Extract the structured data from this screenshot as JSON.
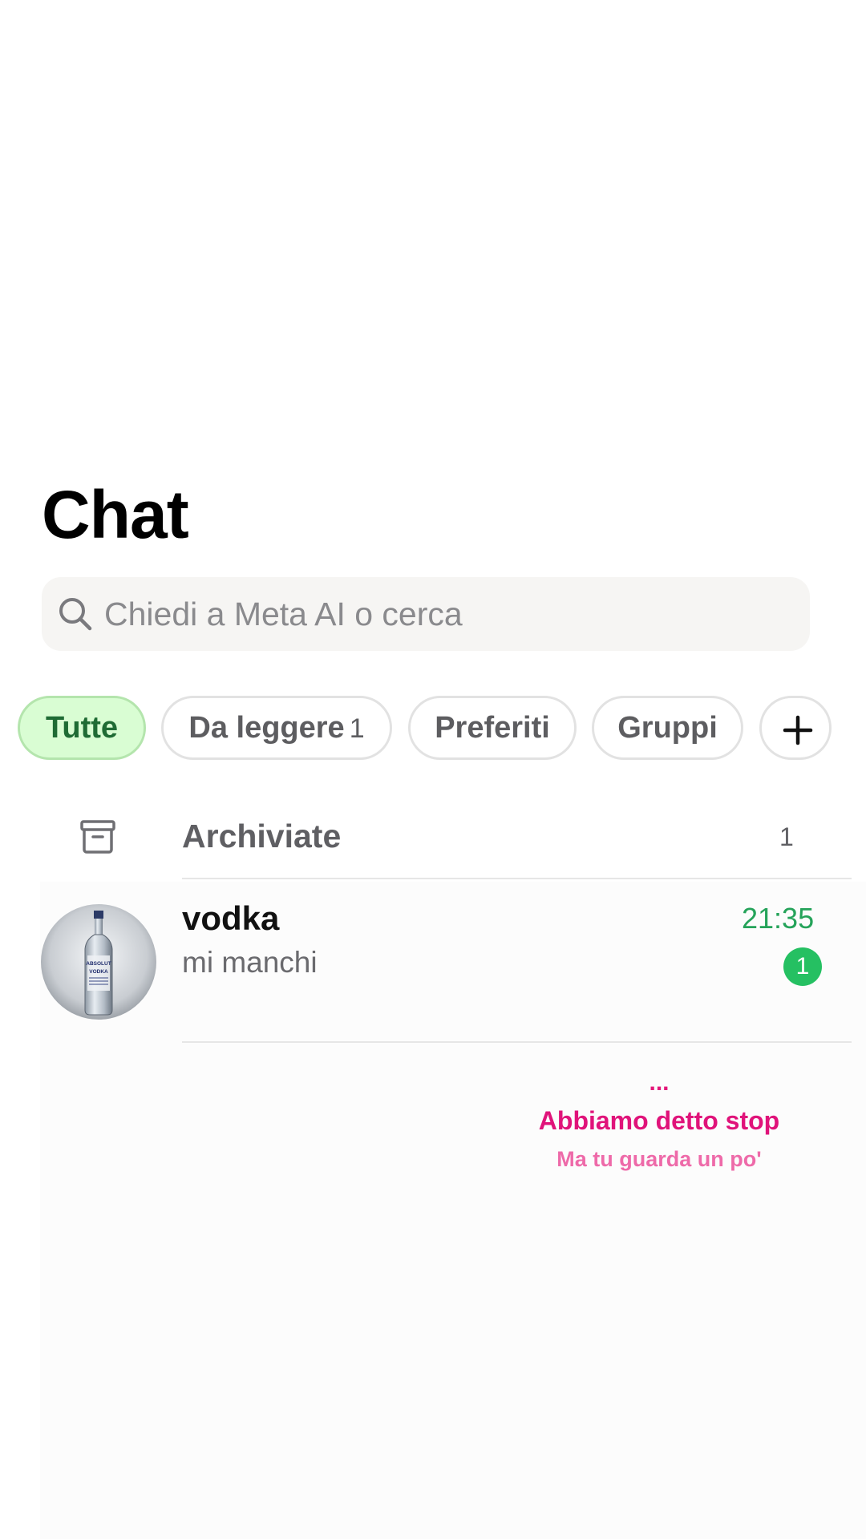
{
  "header": {
    "title": "Chat"
  },
  "search": {
    "placeholder": "Chiedi a Meta AI o cerca",
    "icon": "search-icon"
  },
  "filters": {
    "chips": [
      {
        "label": "Tutte",
        "active": true
      },
      {
        "label": "Da leggere",
        "count": "1",
        "active": false
      },
      {
        "label": "Preferiti",
        "active": false
      },
      {
        "label": "Gruppi",
        "active": false
      }
    ],
    "add_icon": "plus-icon"
  },
  "archived": {
    "label": "Archiviate",
    "count": "1",
    "icon": "archive-icon"
  },
  "chats": [
    {
      "name": "vodka",
      "preview": "mi manchi",
      "time": "21:35",
      "unread": "1",
      "avatar": "vodka-bottle-avatar",
      "bottle_label": [
        "ABSOLUT",
        "VODKA"
      ]
    }
  ],
  "overlay": {
    "dots": "...",
    "line1": "Abbiamo detto stop",
    "line2": "Ma tu guarda un po'"
  },
  "colors": {
    "accent_green": "#25a35a",
    "badge_green": "#25c062",
    "active_chip_bg": "#d9fdd3",
    "overlay_pink": "#e0137a",
    "overlay_light_pink": "#ee6aa9"
  }
}
